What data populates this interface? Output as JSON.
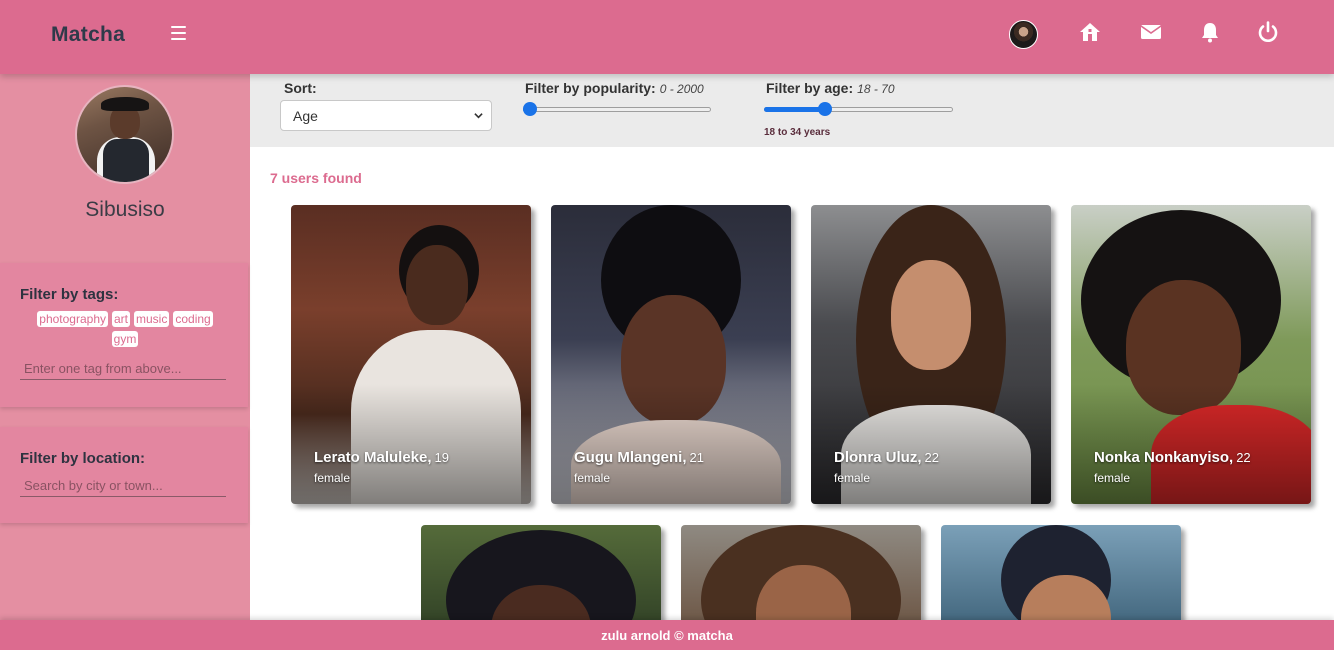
{
  "app": {
    "brand": "Matcha"
  },
  "navbar": {
    "icons": [
      "avatar",
      "home-icon",
      "mail-icon",
      "bell-icon",
      "power-icon"
    ]
  },
  "sidebar": {
    "profile_name": "Sibusiso",
    "tags_title": "Filter by tags:",
    "tags": [
      "photography",
      "art",
      "music",
      "coding",
      "gym"
    ],
    "tag_input_placeholder": "Enter one tag from above...",
    "location_title": "Filter by location:",
    "location_input_placeholder": "Search by city or town..."
  },
  "filters": {
    "sort_label": "Sort:",
    "sort_value": "Age",
    "popularity_label": "Filter by popularity:",
    "popularity_range": "0 - 2000",
    "popularity_value": 0,
    "age_label": "Filter by age:",
    "age_range": "18 - 70",
    "age_value": 34,
    "age_note": "18 to 34 years"
  },
  "results": {
    "count_text": "7 users found",
    "users": [
      {
        "name": "Lerato Maluleke,",
        "age": "19",
        "gender": "female"
      },
      {
        "name": "Gugu Mlangeni,",
        "age": "21",
        "gender": "female"
      },
      {
        "name": "Dlonra Uluz,",
        "age": "22",
        "gender": "female"
      },
      {
        "name": "Nonka Nonkanyiso,",
        "age": "22",
        "gender": "female"
      },
      {
        "name": "",
        "age": "",
        "gender": ""
      },
      {
        "name": "",
        "age": "",
        "gender": ""
      },
      {
        "name": "",
        "age": "",
        "gender": ""
      }
    ]
  },
  "footer": {
    "text": "zulu arnold © matcha"
  },
  "colors": {
    "accent": "#dc6b8f",
    "sidebar": "#e48fa2",
    "slider": "#1a73e8"
  }
}
